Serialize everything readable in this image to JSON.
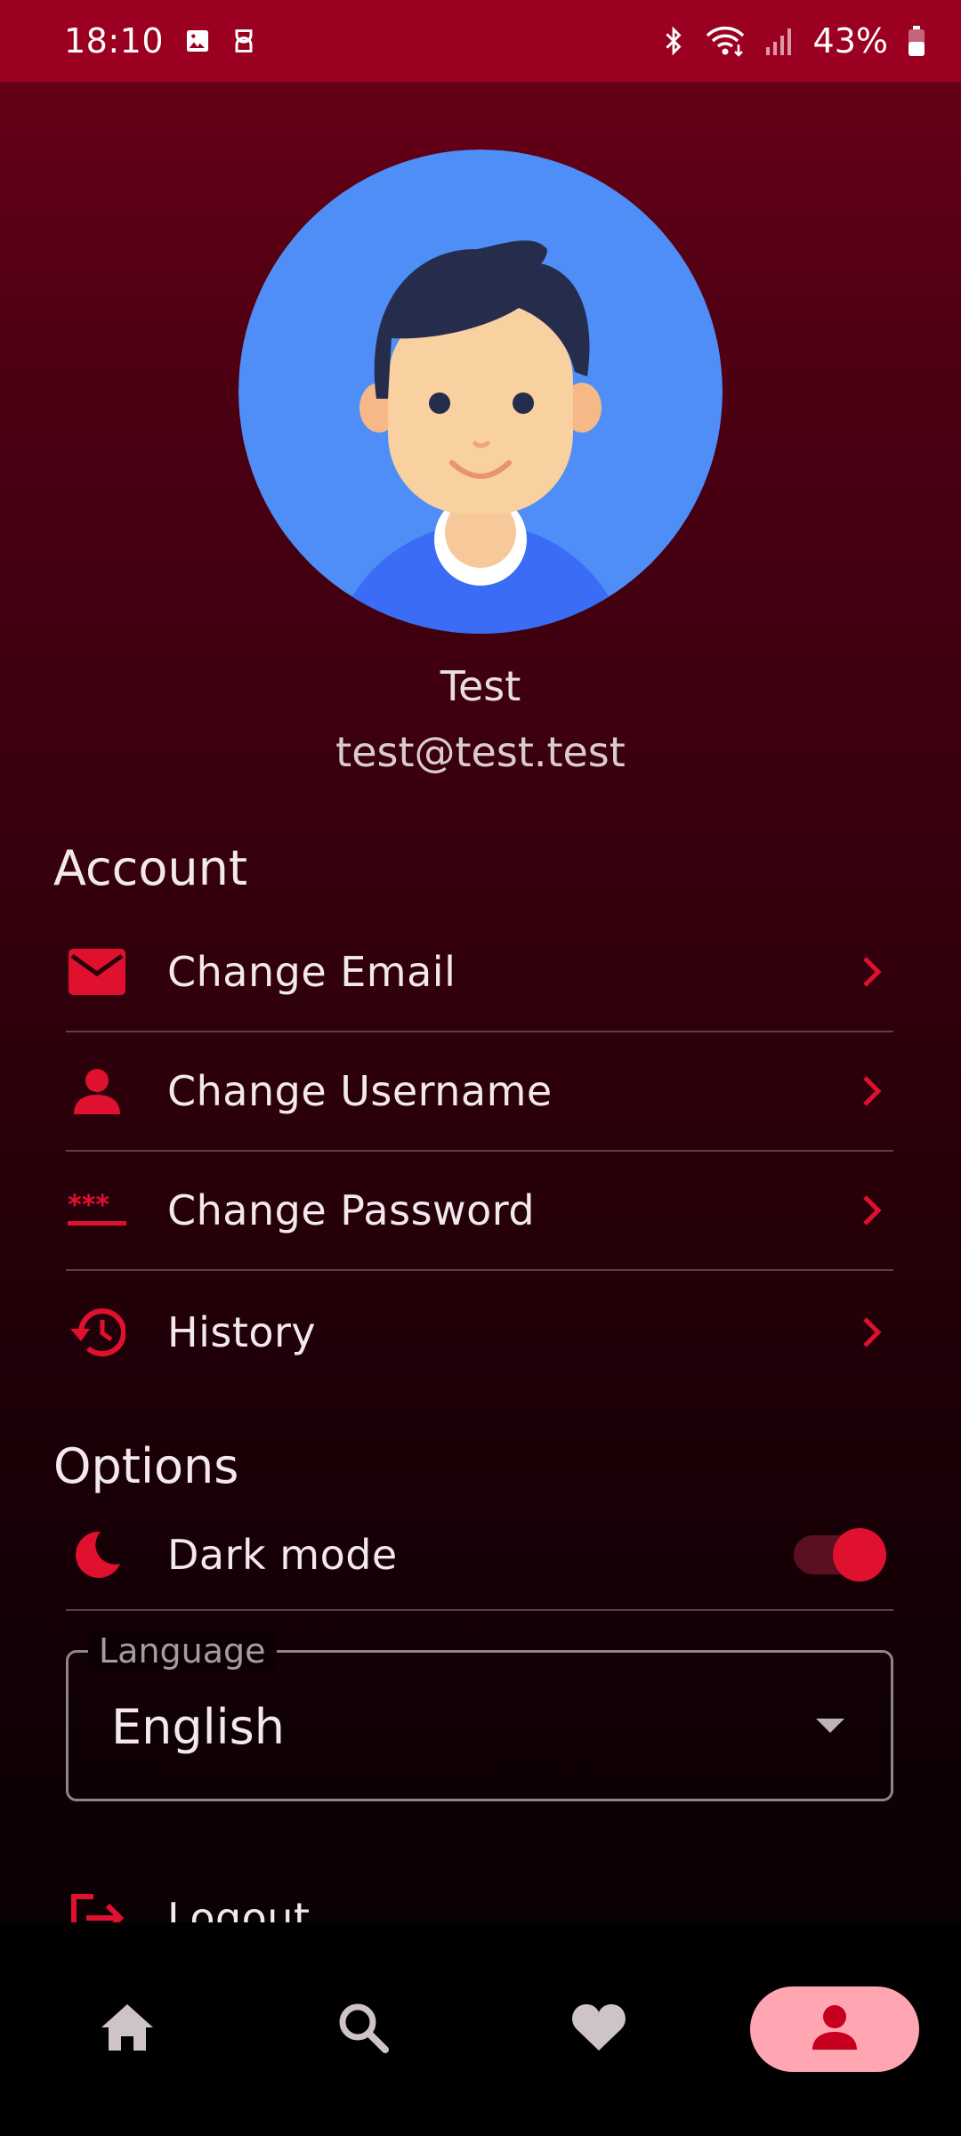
{
  "status_bar": {
    "time": "18:10",
    "battery": "43%"
  },
  "profile": {
    "name": "Test",
    "email": "test@test.test"
  },
  "account": {
    "title": "Account",
    "items": [
      {
        "label": "Change Email",
        "icon": "email-icon"
      },
      {
        "label": "Change Username",
        "icon": "person-icon"
      },
      {
        "label": "Change Password",
        "icon": "password-icon"
      },
      {
        "label": "History",
        "icon": "history-icon"
      }
    ]
  },
  "options": {
    "title": "Options",
    "dark_mode": {
      "label": "Dark mode",
      "enabled": true
    },
    "language": {
      "legend": "Language",
      "value": "English"
    },
    "logout_label": "Logout"
  },
  "bottom_nav": {
    "items": [
      "home-icon",
      "search-icon",
      "heart-icon",
      "profile-icon"
    ],
    "active": "profile-icon"
  },
  "colors": {
    "accent": "#e0102f",
    "status_bar": "#9b0020",
    "active_nav": "#ffa6b2",
    "nav_icon": "#cdc3c8"
  }
}
